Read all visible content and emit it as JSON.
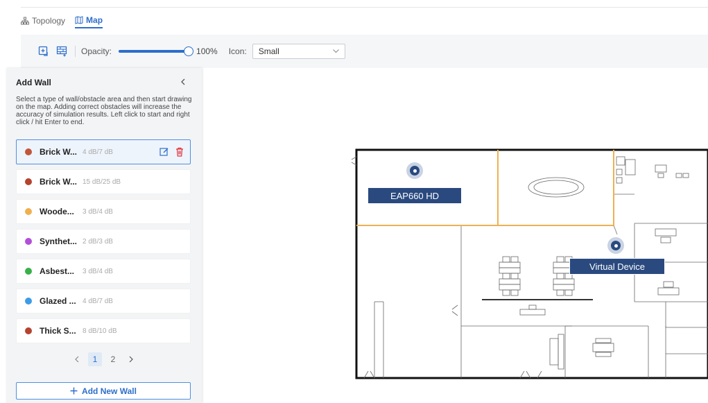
{
  "tabs": [
    {
      "label": "Topology",
      "icon": "topology-icon",
      "active": false
    },
    {
      "label": "Map",
      "icon": "map-icon",
      "active": true
    }
  ],
  "toolbar": {
    "opacity_label": "Opacity:",
    "opacity_value": 100,
    "opacity_text": "100%",
    "icon_label": "Icon:",
    "icon_size_selected": "Small",
    "accent_color": "#2c6ecb"
  },
  "panel": {
    "title": "Add Wall",
    "description": "Select a type of wall/obstacle area and then start drawing on the map. Adding correct obstacles will increase the accuracy of simulation results. Left click to start and right click / hit Enter to end.",
    "walls": [
      {
        "name": "Brick W...",
        "attenuation": "4 dB/7 dB",
        "color": "#c0573a",
        "selected": true
      },
      {
        "name": "Brick W...",
        "attenuation": "15 dB/25 dB",
        "color": "#b5432e",
        "selected": false
      },
      {
        "name": "Woode...",
        "attenuation": "3 dB/4 dB",
        "color": "#f0b050",
        "selected": false
      },
      {
        "name": "Synthet...",
        "attenuation": "2 dB/3 dB",
        "color": "#b24fd8",
        "selected": false
      },
      {
        "name": "Asbest...",
        "attenuation": "3 dB/4 dB",
        "color": "#3ab04a",
        "selected": false
      },
      {
        "name": "Glazed ...",
        "attenuation": "4 dB/7 dB",
        "color": "#3d9ce8",
        "selected": false
      },
      {
        "name": "Thick S...",
        "attenuation": "8 dB/10 dB",
        "color": "#b5432e",
        "selected": false
      }
    ],
    "pagination": {
      "pages": [
        "1",
        "2"
      ],
      "current": "1"
    },
    "add_button": "Add New Wall"
  },
  "map": {
    "devices": [
      {
        "label": "EAP660 HD"
      },
      {
        "label": "Virtual Device"
      }
    ]
  }
}
